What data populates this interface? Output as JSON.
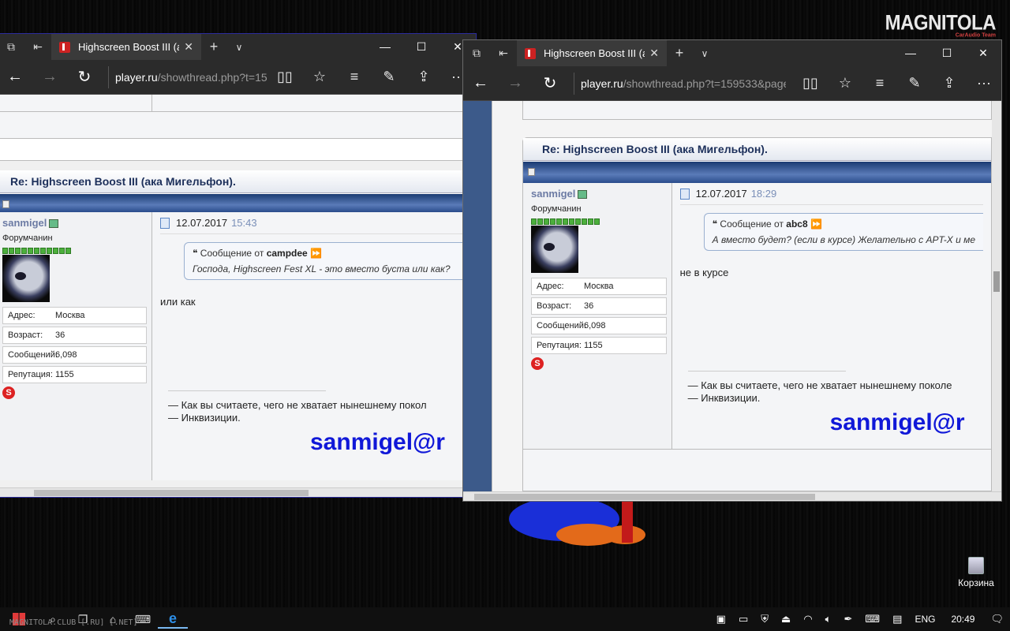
{
  "desktop": {
    "logo_main": "MAGNITOLA",
    "logo_sub": "CarAudio Team",
    "recycle_label": "Корзина"
  },
  "left_window": {
    "tab_title": "Highscreen Boost III (ак",
    "url_domain": "player.ru",
    "url_path": "/showthread.php?t=15",
    "post": {
      "title": "Re: Highscreen Boost III (ака Мигельфон).",
      "user": "sanmigel",
      "rank": "Форумчанин",
      "info": [
        {
          "label": "Адрес:",
          "value": "Москва"
        },
        {
          "label": "Возраст:",
          "value": "36"
        },
        {
          "label": "Сообщений:",
          "value": "6,098"
        },
        {
          "label": "Репутация:",
          "value": "1155"
        }
      ],
      "date": "12.07.2017",
      "time": "15:43",
      "quote_prefix": "Сообщение от",
      "quote_author": "campdee",
      "quote_text": "Господа, Highscreen Fest XL - это вместо буста или как?",
      "message": "или как",
      "sig_line1": "— Как вы считаете, чего не хватает нынешнему покол",
      "sig_line2": "— Инквизиции.",
      "sig_big": "sanmigel@r"
    }
  },
  "right_window": {
    "tab_title": "Highscreen Boost III (ак",
    "url_domain": "player.ru",
    "url_path": "/showthread.php?t=159533&page",
    "post": {
      "title": "Re: Highscreen Boost III (ака Мигельфон).",
      "user": "sanmigel",
      "rank": "Форумчанин",
      "info": [
        {
          "label": "Адрес:",
          "value": "Москва"
        },
        {
          "label": "Возраст:",
          "value": "36"
        },
        {
          "label": "Сообщений:",
          "value": "6,098"
        },
        {
          "label": "Репутация:",
          "value": "1155"
        }
      ],
      "date": "12.07.2017",
      "time": "18:29",
      "quote_prefix": "Сообщение от",
      "quote_author": "abc8",
      "quote_text": "А вместо будет? (если в курсе) Желательно с APT-X и ме",
      "message": "не в курсе",
      "sig_line1": "— Как вы считаете, чего не хватает нынешнему поколе",
      "sig_line2": "— Инквизиции.",
      "sig_big": "sanmigel@r"
    }
  },
  "taskbar": {
    "watermark": "MAGNITOLA.CLUB [.RU] [.NET]",
    "lang": "ENG",
    "time": "20:49"
  },
  "icons": {
    "skype": "S",
    "back": "←",
    "forward": "→",
    "refresh": "↻",
    "reading": "▯▯",
    "favorite": "☆",
    "hub": "≡",
    "notes": "✎",
    "share": "⇪",
    "more": "···",
    "new_tab": "+",
    "tab_list": "∨",
    "tab_close": "✕",
    "minimize": "—",
    "maximize": "☐",
    "close": "✕"
  }
}
